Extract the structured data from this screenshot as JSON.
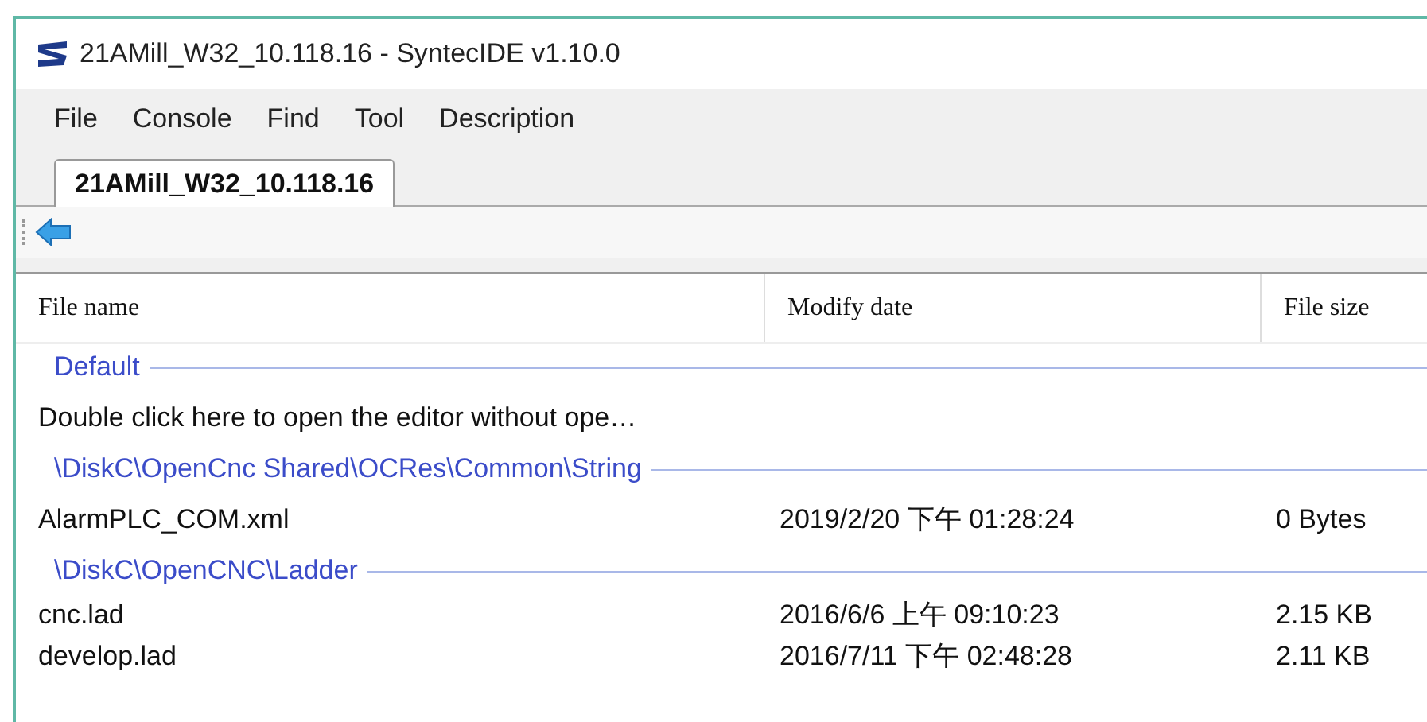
{
  "window": {
    "title": "21AMill_W32_10.118.16 - SyntecIDE v1.10.0"
  },
  "menu": [
    "File",
    "Console",
    "Find",
    "Tool",
    "Description"
  ],
  "tabs": [
    {
      "label": "21AMill_W32_10.118.16",
      "selected": true
    }
  ],
  "table": {
    "columns": [
      "File name",
      "Modify date",
      "File size"
    ],
    "groups": [
      {
        "label": "Default",
        "rows": [
          {
            "name": "Double click here to open the editor without ope…"
          }
        ]
      },
      {
        "label": "\\DiskC\\OpenCnc Shared\\OCRes\\Common\\String",
        "rows": [
          {
            "name": "AlarmPLC_COM.xml",
            "date": "2019/2/20 下午 01:28:24",
            "size": "0 Bytes"
          }
        ]
      },
      {
        "label": "\\DiskC\\OpenCNC\\Ladder",
        "rows": [
          {
            "name": "cnc.lad",
            "date": "2016/6/6 上午 09:10:23",
            "size": "2.15 KB"
          },
          {
            "name": "develop.lad",
            "date": "2016/7/11 下午 02:48:28",
            "size": "2.11 KB"
          }
        ]
      }
    ]
  }
}
